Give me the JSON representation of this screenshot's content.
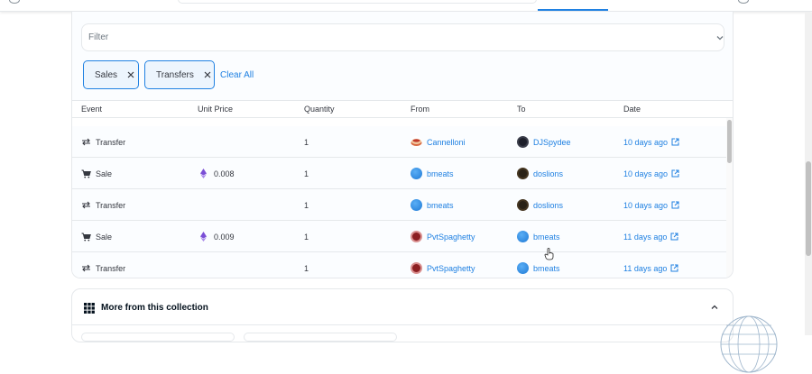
{
  "filter": {
    "placeholder": "Filter",
    "chips": [
      {
        "label": "Sales"
      },
      {
        "label": "Transfers"
      }
    ],
    "clear_all_label": "Clear All"
  },
  "table": {
    "columns": [
      "Event",
      "Unit Price",
      "Quantity",
      "From",
      "To",
      "Date"
    ],
    "rows": [
      {
        "event": "Transfer",
        "event_icon": "transfer-arrows-icon",
        "price": "",
        "quantity": "1",
        "from": "Cannelloni",
        "from_avatar": "cannelloni-avatar",
        "to": "DJSpydee",
        "to_avatar": "djspydee-avatar",
        "date": "10 days ago"
      },
      {
        "event": "Sale",
        "event_icon": "cart-icon",
        "price": "0.008",
        "quantity": "1",
        "from": "bmeats",
        "from_avatar": "bmeats-avatar",
        "to": "doslions",
        "to_avatar": "doslions-avatar",
        "date": "10 days ago"
      },
      {
        "event": "Transfer",
        "event_icon": "transfer-arrows-icon",
        "price": "",
        "quantity": "1",
        "from": "bmeats",
        "from_avatar": "bmeats-avatar",
        "to": "doslions",
        "to_avatar": "doslions-avatar",
        "date": "10 days ago"
      },
      {
        "event": "Sale",
        "event_icon": "cart-icon",
        "price": "0.009",
        "quantity": "1",
        "from": "PvtSpaghetty",
        "from_avatar": "pvtspaghetty-avatar",
        "to": "bmeats",
        "to_avatar": "bmeats-avatar",
        "date": "11 days ago"
      },
      {
        "event": "Transfer",
        "event_icon": "transfer-arrows-icon",
        "price": "",
        "quantity": "1",
        "from": "PvtSpaghetty",
        "from_avatar": "pvtspaghetty-avatar",
        "to": "bmeats",
        "to_avatar": "bmeats-avatar",
        "date": "11 days ago"
      }
    ]
  },
  "collection": {
    "title": "More from this collection",
    "icon": "grid-icon"
  },
  "colors": {
    "accent": "#2081e2",
    "text": "#353840",
    "border": "#e5e8eb",
    "eth": "#6f42c1"
  }
}
